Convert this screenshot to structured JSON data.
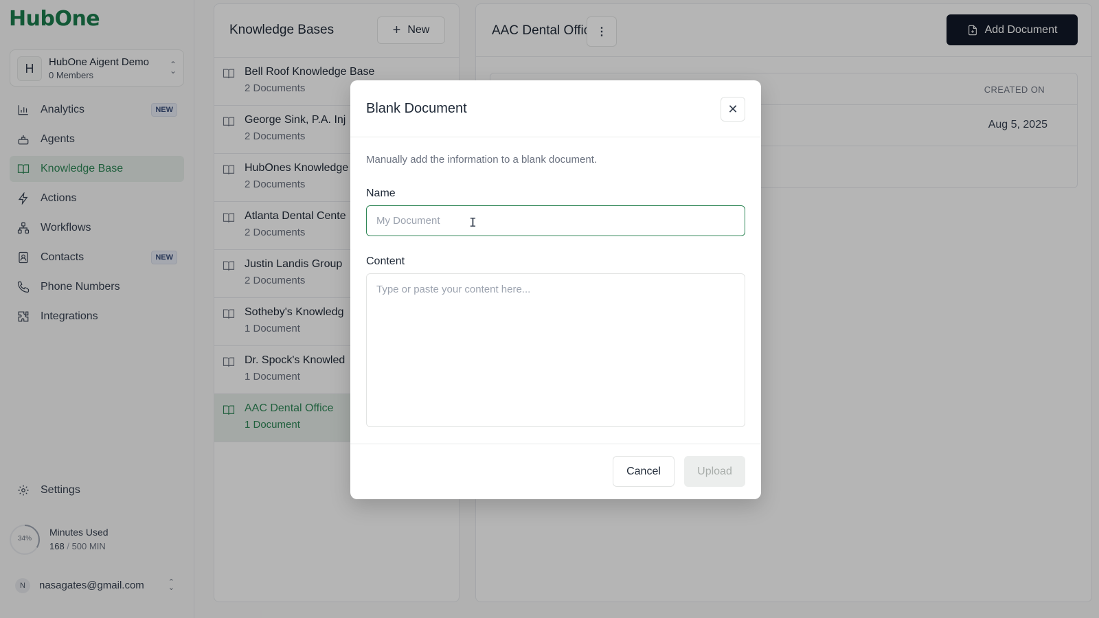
{
  "brand": {
    "logo_text": "HubOne",
    "accent": "#2f8656",
    "logo_color": "#1a7a4c"
  },
  "workspace": {
    "initial": "H",
    "name": "HubOne Aigent Demo",
    "members": "0 Members"
  },
  "sidebar": {
    "items": [
      {
        "label": "Analytics",
        "icon": "chart-icon",
        "badge": "NEW"
      },
      {
        "label": "Agents",
        "icon": "agent-icon",
        "badge": ""
      },
      {
        "label": "Knowledge Base",
        "icon": "book-icon",
        "badge": "",
        "active": true
      },
      {
        "label": "Actions",
        "icon": "bolt-icon",
        "badge": ""
      },
      {
        "label": "Workflows",
        "icon": "workflow-icon",
        "badge": ""
      },
      {
        "label": "Contacts",
        "icon": "contacts-icon",
        "badge": "NEW"
      },
      {
        "label": "Phone Numbers",
        "icon": "phone-icon",
        "badge": ""
      },
      {
        "label": "Integrations",
        "icon": "puzzle-icon",
        "badge": ""
      }
    ],
    "settings_label": "Settings"
  },
  "usage": {
    "percent_label": "34%",
    "percent": 0.34,
    "title": "Minutes Used",
    "used": "168",
    "sep": "/",
    "limit": "500 MIN"
  },
  "account": {
    "initial": "N",
    "email": "nasagates@gmail.com"
  },
  "kb_panel": {
    "title": "Knowledge Bases",
    "new_label": "New",
    "items": [
      {
        "name": "Bell Roof Knowledge Base",
        "count": "2 Documents"
      },
      {
        "name": "George Sink, P.A. Inj",
        "count": "2 Documents"
      },
      {
        "name": "HubOnes Knowledge",
        "count": "2 Documents"
      },
      {
        "name": "Atlanta Dental Cente",
        "count": "2 Documents"
      },
      {
        "name": "Justin Landis Group",
        "count": "2 Documents"
      },
      {
        "name": "Sotheby's Knowledg",
        "count": "1 Document"
      },
      {
        "name": "Dr. Spock's Knowled",
        "count": "1 Document"
      },
      {
        "name": "AAC Dental Office",
        "count": "1 Document",
        "active": true
      }
    ]
  },
  "detail": {
    "title": "AAC Dental Office",
    "menu_glyph": "⋮",
    "add_label": "Add Document",
    "table": {
      "col_created": "CREATED ON",
      "rows": [
        {
          "created": "Aug 5, 2025"
        }
      ]
    }
  },
  "modal": {
    "title": "Blank Document",
    "close_glyph": "✕",
    "description": "Manually add the information to a blank document.",
    "name_label": "Name",
    "name_placeholder": "My Document",
    "name_value": "",
    "content_label": "Content",
    "content_placeholder": "Type or paste your content here...",
    "content_value": "",
    "cancel_label": "Cancel",
    "upload_label": "Upload"
  }
}
